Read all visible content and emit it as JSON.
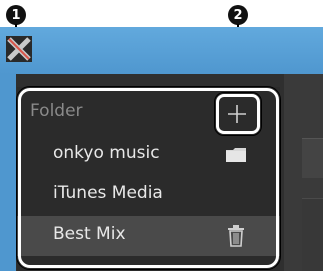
{
  "callouts": [
    "1",
    "2"
  ],
  "panel": {
    "header_label": "Folder",
    "add_icon": "plus-icon",
    "items": [
      {
        "label": "onkyo music",
        "icon": "folder-icon",
        "selected": false
      },
      {
        "label": "iTunes Media",
        "icon": "",
        "selected": false
      },
      {
        "label": "Best Mix",
        "icon": "trash-icon",
        "selected": true
      }
    ]
  },
  "colors": {
    "titlebar": "#4f97cf",
    "panel_bg": "#2b2b2b",
    "selected_row": "#4a4a4a",
    "highlight_frame": "#ffffff"
  }
}
